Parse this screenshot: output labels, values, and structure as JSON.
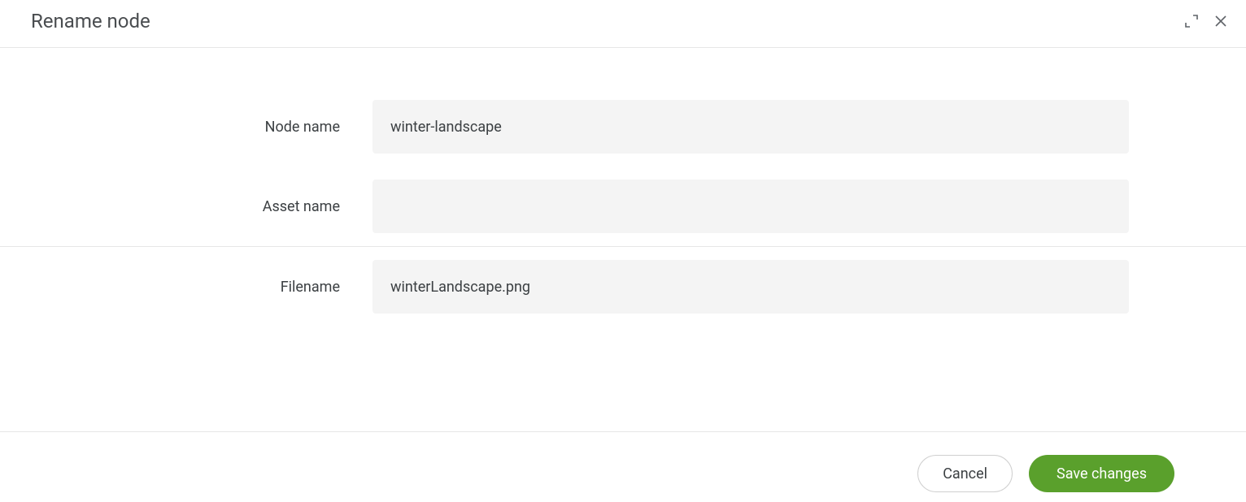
{
  "dialog": {
    "title": "Rename node"
  },
  "form": {
    "node_name": {
      "label": "Node name",
      "value": "winter-landscape"
    },
    "asset_name": {
      "label": "Asset name",
      "value": ""
    },
    "filename": {
      "label": "Filename",
      "value": "winterLandscape.png"
    }
  },
  "footer": {
    "cancel_label": "Cancel",
    "save_label": "Save changes"
  }
}
